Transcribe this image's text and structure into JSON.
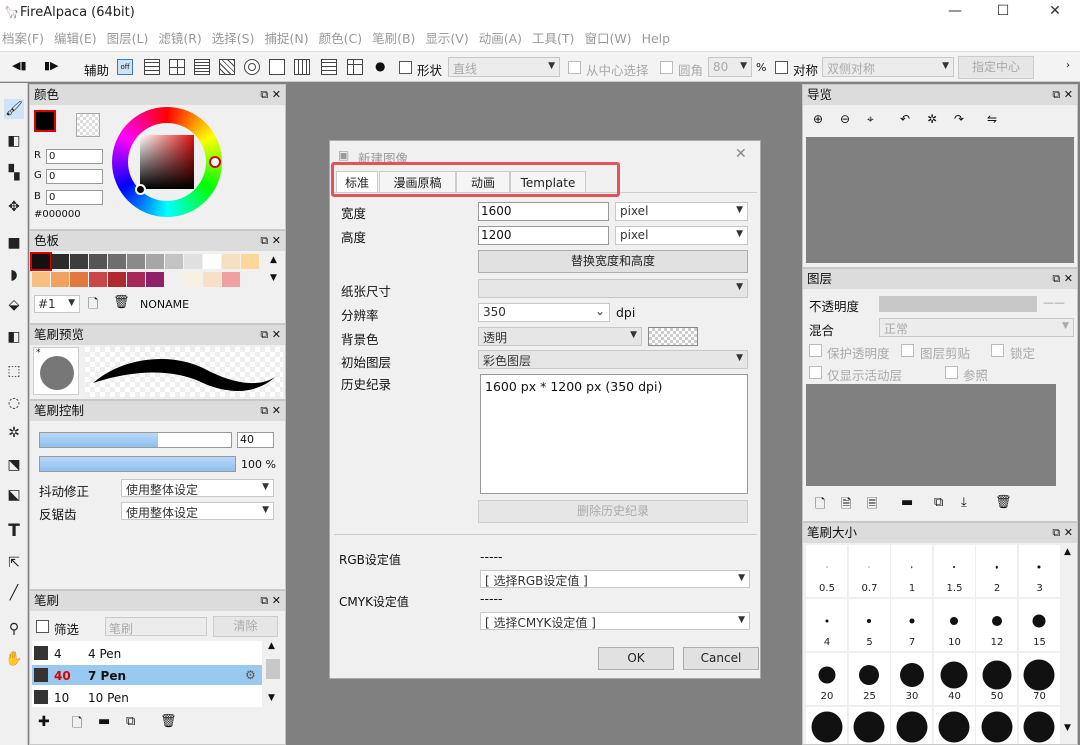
{
  "window": {
    "title": "FireAlpaca (64bit)",
    "minimize": "—",
    "maximize": "☐",
    "close": "✕"
  },
  "menu": [
    "档案(F)",
    "编辑(E)",
    "图层(L)",
    "滤镜(R)",
    "选择(S)",
    "捕捉(N)",
    "颜色(C)",
    "笔刷(B)",
    "显示(V)",
    "动画(A)",
    "工具(T)",
    "窗口(W)",
    "Help"
  ],
  "toolbar": {
    "assist": "辅助",
    "shape": "形状",
    "shape_value": "直线",
    "from_center": "从中心选择",
    "round": "圆角",
    "round_value": "80",
    "percent": "%",
    "symmetry": "对称",
    "symmetry_value": "双侧对称",
    "set_center": "指定中心"
  },
  "color_panel": {
    "title": "颜色",
    "r_label": "R",
    "r": "0",
    "g_label": "G",
    "g": "0",
    "b_label": "B",
    "b": "0",
    "hex": "#000000",
    "fg_color": "#000000"
  },
  "palette_panel": {
    "title": "色板",
    "selected": "#1",
    "name": "NONAME",
    "colors": [
      "#111111",
      "#2b2b2b",
      "#3d3d3d",
      "#555555",
      "#6e6e6e",
      "#8a8a8a",
      "#a6a6a6",
      "#c3c3c3",
      "#e0e0e0",
      "#ffffff",
      "#f6e0c0",
      "#fbd89a",
      "#f7c080",
      "#f2a060",
      "#e07840",
      "#c84848",
      "#b02830",
      "#a82858",
      "#902068",
      "#f0f0f0",
      "#f8f0e0",
      "#f8e0c8",
      "#f0a0a0"
    ]
  },
  "brush_preview": {
    "title": "笔刷预览",
    "marker": "*"
  },
  "brush_control": {
    "title": "笔刷控制",
    "size": "40",
    "opacity": "100 %",
    "size_fraction": 0.62,
    "opacity_fraction": 1.0,
    "stabilizer_label": "抖动修正",
    "stabilizer_value": "使用整体设定",
    "antialias_label": "反锯齿",
    "antialias_value": "使用整体设定"
  },
  "brush_panel": {
    "title": "笔刷",
    "filter_label": "筛选",
    "filter_placeholder": "笔刷",
    "clear": "清除",
    "items": [
      {
        "size": "4",
        "name": "4 Pen",
        "selected": false
      },
      {
        "size": "40",
        "name": "7 Pen",
        "selected": true
      },
      {
        "size": "10",
        "name": "10 Pen",
        "selected": false
      }
    ]
  },
  "navigator": {
    "title": "导览"
  },
  "layers": {
    "title": "图层",
    "opacity_label": "不透明度",
    "opacity_value": "——",
    "blend_label": "混合",
    "blend_value": "正常",
    "protect_alpha": "保护透明度",
    "clipping": "图层剪贴",
    "lock": "锁定",
    "show_active_only": "仅显示活动层",
    "reference": "参照"
  },
  "brush_size": {
    "title": "笔刷大小",
    "sizes": [
      {
        "label": "0.5",
        "d": 1
      },
      {
        "label": "0.7",
        "d": 1
      },
      {
        "label": "1",
        "d": 1.5
      },
      {
        "label": "1.5",
        "d": 2
      },
      {
        "label": "2",
        "d": 2.5
      },
      {
        "label": "3",
        "d": 3
      },
      {
        "label": "4",
        "d": 3
      },
      {
        "label": "5",
        "d": 4
      },
      {
        "label": "7",
        "d": 5
      },
      {
        "label": "10",
        "d": 8
      },
      {
        "label": "12",
        "d": 10
      },
      {
        "label": "15",
        "d": 13
      },
      {
        "label": "20",
        "d": 17
      },
      {
        "label": "25",
        "d": 20
      },
      {
        "label": "30",
        "d": 24
      },
      {
        "label": "40",
        "d": 27
      },
      {
        "label": "50",
        "d": 29
      },
      {
        "label": "70",
        "d": 31
      },
      {
        "label": "",
        "d": 31
      },
      {
        "label": "",
        "d": 31
      },
      {
        "label": "",
        "d": 31
      },
      {
        "label": "",
        "d": 31
      },
      {
        "label": "",
        "d": 31
      },
      {
        "label": "",
        "d": 31
      }
    ]
  },
  "dialog": {
    "title": "新建图像",
    "tabs": [
      "标准",
      "漫画原稿",
      "动画",
      "Template"
    ],
    "width_label": "宽度",
    "width": "1600",
    "width_unit": "pixel",
    "height_label": "高度",
    "height": "1200",
    "height_unit": "pixel",
    "swap": "替换宽度和高度",
    "paper_label": "纸张尺寸",
    "paper_value": "",
    "dpi_label": "分辨率",
    "dpi": "350",
    "dpi_unit": "dpi",
    "bg_label": "背景色",
    "bg_value": "透明",
    "layer_label": "初始图层",
    "layer_value": "彩色图层",
    "history_label": "历史纪录",
    "history_items": [
      "1600 px * 1200 px (350 dpi)"
    ],
    "clear_history": "删除历史纪录",
    "rgb_label": "RGB设定值",
    "rgb_dash": "-----",
    "rgb_select": "[ 选择RGB设定值 ]",
    "cmyk_label": "CMYK设定值",
    "cmyk_dash": "-----",
    "cmyk_select": "[ 选择CMYK设定值 ]",
    "ok": "OK",
    "cancel": "Cancel",
    "highlight_color": "#e8505b"
  }
}
